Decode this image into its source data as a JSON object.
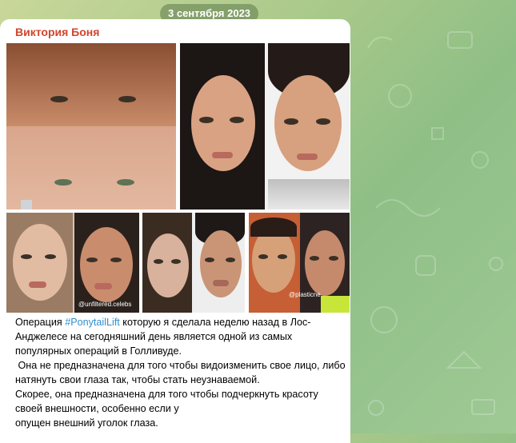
{
  "date_label": "3 сентября 2023",
  "sender": "Виктория Боня",
  "message": {
    "text_before_hashtag": "Операция ",
    "hashtag": "#PonytailLift",
    "text_after_hashtag": " которую я сделала неделю назад в Лос-Анджелесе на сегодняшний день является одной из самых популярных операций в Голливуде.",
    "line_2": " Она не предназначена для того чтобы видоизменить свое лицо, либо натянуть свои глаза так, чтобы стать неузнаваемой.",
    "line_3": "Скорее, она предназначена для того чтобы подчеркнуть красоту своей внешности, особенно если у",
    "line_4": "опущен внешний уголок глаза."
  },
  "photos": [
    {
      "name": "photo-bella-before-after"
    },
    {
      "name": "photo-kendall-before-after"
    },
    {
      "name": "photo-hailey-before-after"
    },
    {
      "name": "photo-kylie-before-after"
    },
    {
      "name": "photo-bella-comparison"
    }
  ],
  "watermarks": {
    "hailey": "@unfiltered.celebs",
    "bella": "@plasticne"
  },
  "colors": {
    "sender": "#d2452c",
    "hashtag": "#2f8fd0",
    "bubble": "#ffffff",
    "date_pill": "#5c7a4c"
  }
}
